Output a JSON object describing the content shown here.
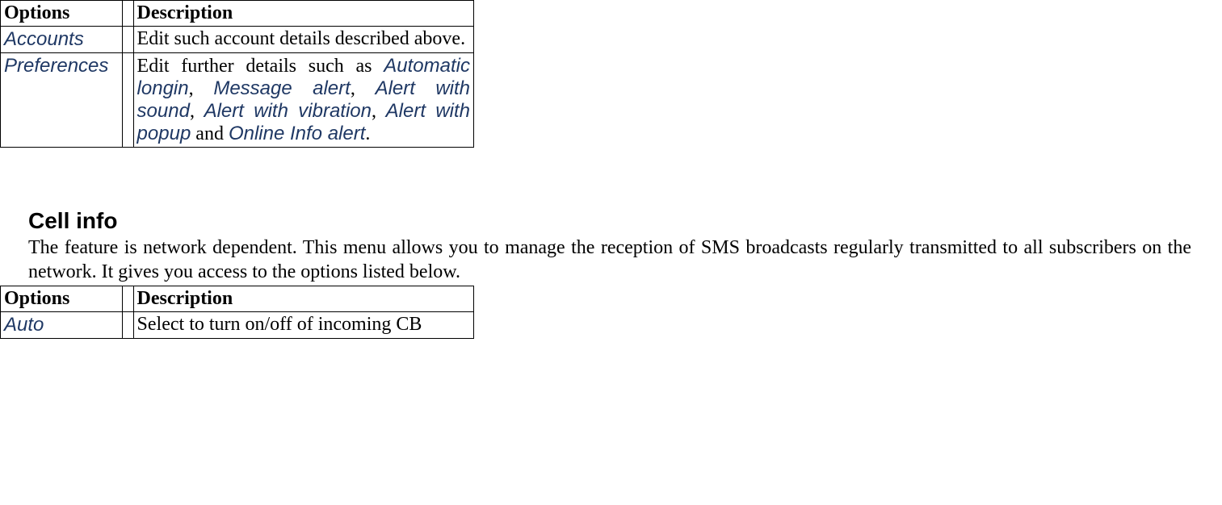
{
  "table1": {
    "headers": {
      "options": "Options",
      "description": "Description"
    },
    "rows": [
      {
        "option": "Accounts",
        "description": "Edit such account details described above."
      },
      {
        "option": "Preferences",
        "description_prefix": "Edit further details such as ",
        "t1": "Automatic longin",
        "s1": ", ",
        "t2": "Message alert",
        "s2": ", ",
        "t3": "Alert with sound",
        "s3": ", ",
        "t4": "Alert with vibration",
        "s4": ", ",
        "t5": "Alert with popup",
        "s5": " and ",
        "t6": "Online Info alert",
        "s6": "."
      }
    ]
  },
  "cellinfo": {
    "title": "Cell info",
    "intro": "The feature is network dependent. This menu allows you to manage the reception of SMS broadcasts regularly transmitted to all subscribers on the network. It gives you access to the options listed below.",
    "headers": {
      "options": "Options",
      "description": "Description"
    },
    "rows": [
      {
        "option": "Auto",
        "description": "Select to turn on/off of incoming CB"
      }
    ]
  }
}
